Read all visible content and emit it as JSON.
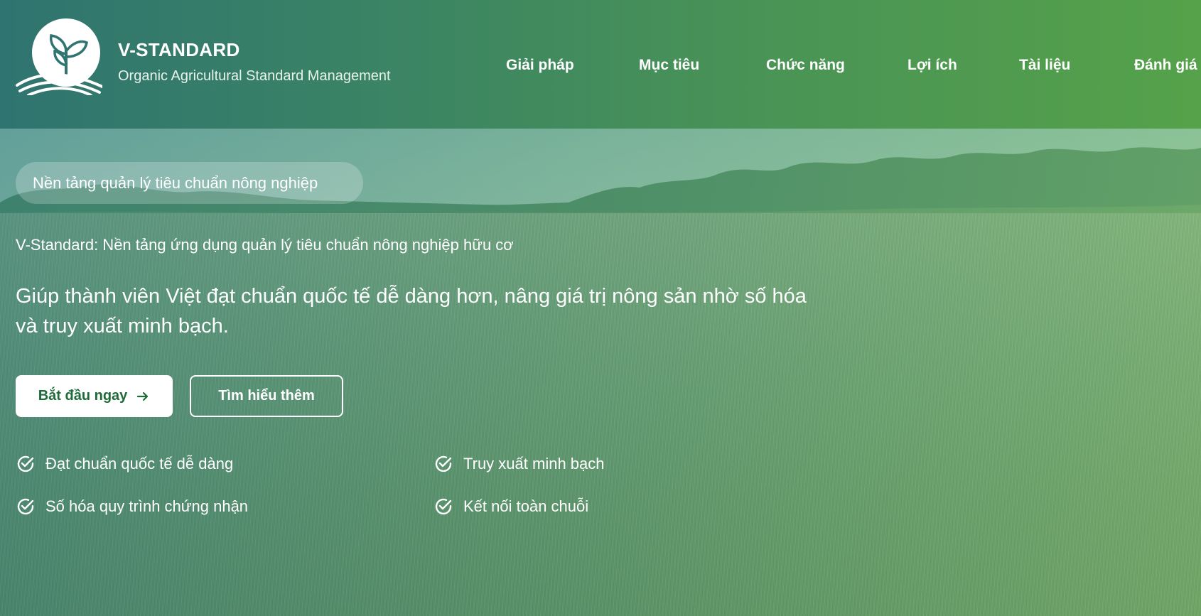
{
  "brand": {
    "title": "V-STANDARD",
    "subtitle": "Organic Agricultural Standard Management",
    "logo_icon": "sprout-over-field-icon"
  },
  "nav": {
    "items": [
      {
        "label": "Giải pháp"
      },
      {
        "label": "Mục tiêu"
      },
      {
        "label": "Chức năng"
      },
      {
        "label": "Lợi ích"
      },
      {
        "label": "Tài liệu"
      },
      {
        "label": "Đánh giá"
      }
    ]
  },
  "hero": {
    "badge": "Nền tảng quản lý tiêu chuẩn nông nghiệp",
    "subtitle": "V-Standard: Nền tảng ứng dụng quản lý tiêu chuẩn nông nghiệp hữu cơ",
    "headline_line1": "Giúp thành viên Việt đạt chuẩn quốc tế dễ dàng hơn, nâng giá trị nông sản nhờ số hóa",
    "headline_line2": "và truy xuất minh bạch.",
    "primary_button": "Bắt đầu ngay",
    "primary_button_icon": "arrow-right-icon",
    "secondary_button": "Tìm hiểu thêm",
    "features": [
      {
        "label": "Đạt chuẩn quốc tế dễ dàng",
        "icon": "check-circle-icon"
      },
      {
        "label": "Truy xuất minh bạch",
        "icon": "check-circle-icon"
      },
      {
        "label": "Số hóa quy trình chứng nhận",
        "icon": "check-circle-icon"
      },
      {
        "label": "Kết nối toàn chuỗi",
        "icon": "check-circle-icon"
      }
    ]
  },
  "colors": {
    "header_start": "#2f7470",
    "header_end": "#55a24a",
    "primary_button_text": "#1d6b38"
  }
}
